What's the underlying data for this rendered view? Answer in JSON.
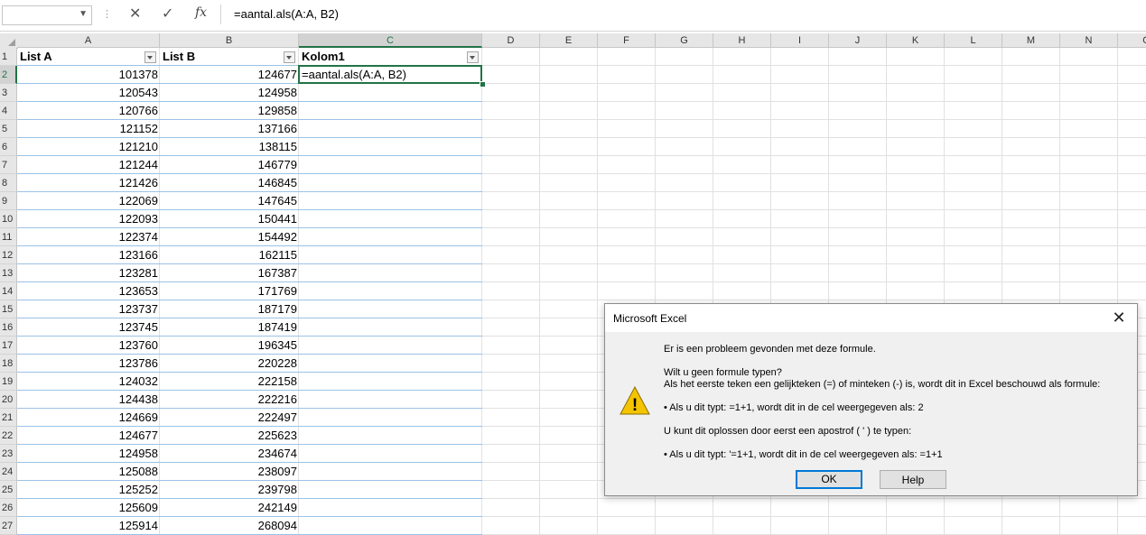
{
  "formula_bar": {
    "name_box": "",
    "cancel_glyph": "✕",
    "enter_glyph": "✓",
    "fx_label": "fx",
    "formula": "=aantal.als(A:A, B2)"
  },
  "columns": [
    "A",
    "B",
    "C",
    "D",
    "E",
    "F",
    "G",
    "H",
    "I",
    "J",
    "K",
    "L",
    "M",
    "N",
    "O"
  ],
  "rows": [
    "1",
    "2",
    "3",
    "4",
    "5",
    "6",
    "7",
    "8",
    "9",
    "10",
    "11",
    "12",
    "13",
    "14",
    "15",
    "16",
    "17",
    "18",
    "19",
    "20",
    "21",
    "22",
    "23",
    "24",
    "25",
    "26",
    "27"
  ],
  "table": {
    "headers": [
      "List A",
      "List B",
      "Kolom1"
    ],
    "list_a": [
      "101378",
      "120543",
      "120766",
      "121152",
      "121210",
      "121244",
      "121426",
      "122069",
      "122093",
      "122374",
      "123166",
      "123281",
      "123653",
      "123737",
      "123745",
      "123760",
      "123786",
      "124032",
      "124438",
      "124669",
      "124677",
      "124958",
      "125088",
      "125252",
      "125609",
      "125914"
    ],
    "list_b": [
      "124677",
      "124958",
      "129858",
      "137166",
      "138115",
      "146779",
      "146845",
      "147645",
      "150441",
      "154492",
      "162115",
      "167387",
      "171769",
      "187179",
      "187419",
      "196345",
      "220228",
      "222158",
      "222216",
      "222497",
      "225623",
      "234674",
      "238097",
      "239798",
      "242149",
      "268094"
    ],
    "c2_value": "=aantal.als(A:A, B2)"
  },
  "dialog": {
    "title": "Microsoft Excel",
    "close_glyph": "✕",
    "line1": "Er is een probleem gevonden met deze formule.",
    "line2": "Wilt u geen formule typen?",
    "line3": "Als het eerste teken een gelijkteken (=) of minteken (-) is, wordt dit in Excel beschouwd als formule:",
    "line4": "• Als u dit typt:   =1+1, wordt dit in de cel weergegeven als:   2",
    "line5": "U kunt dit oplossen door eerst een apostrof ( ' ) te typen:",
    "line6": "• Als u dit typt:   '=1+1, wordt dit in de cel weergegeven als:   =1+1",
    "icon_glyph": "!",
    "ok_label": "OK",
    "help_label": "Help"
  },
  "colors": {
    "accent": "#217346",
    "table_border": "#9bc2e6",
    "warning": "#f5c400"
  }
}
